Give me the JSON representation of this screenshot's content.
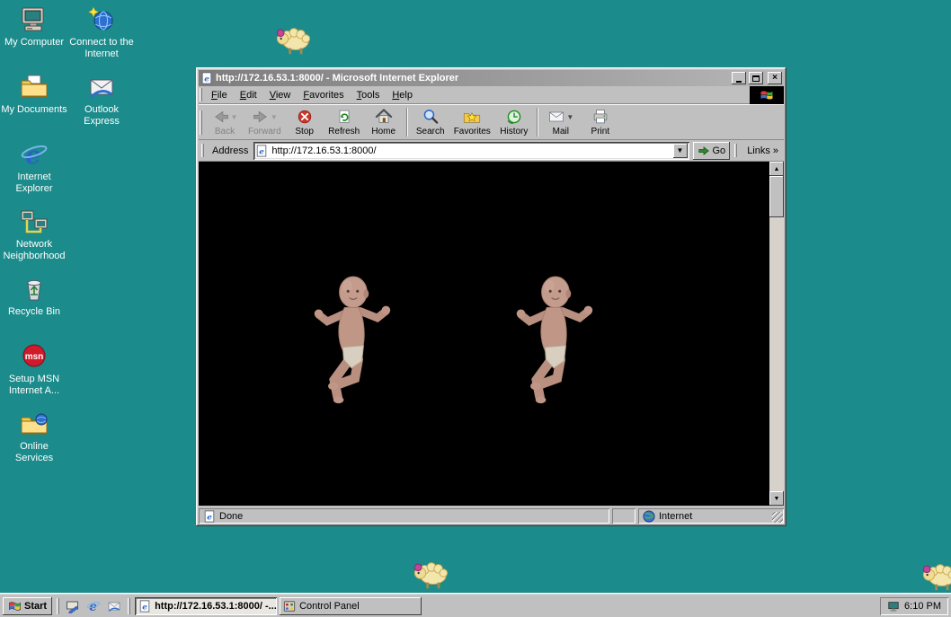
{
  "colors": {
    "desktop_teal": "#1b8b8b",
    "window_face": "#c0c0c0",
    "title_gradient_start": "#7d7d7d",
    "title_gradient_end": "#b6b6b6",
    "content_background": "#000000",
    "msn_red": "#cf1b2b",
    "stop_red": "#c9372a",
    "go_green": "#2d8a2d"
  },
  "desktop": {
    "icons": [
      {
        "name": "my-computer",
        "label": "My Computer"
      },
      {
        "name": "connect-internet",
        "label": "Connect to the Internet"
      },
      {
        "name": "my-documents",
        "label": "My Documents"
      },
      {
        "name": "outlook-express",
        "label": "Outlook Express"
      },
      {
        "name": "internet-explorer",
        "label": "Internet Explorer"
      },
      {
        "name": "network-neighborhood",
        "label": "Network Neighborhood"
      },
      {
        "name": "recycle-bin",
        "label": "Recycle Bin"
      },
      {
        "name": "setup-msn",
        "label": "Setup MSN Internet A..."
      },
      {
        "name": "online-services",
        "label": "Online Services"
      }
    ]
  },
  "icons_text": {
    "msn": "msn"
  },
  "ie": {
    "title": "http://172.16.53.1:8000/ - Microsoft Internet Explorer",
    "menu": {
      "file": "File",
      "edit": "Edit",
      "view": "View",
      "favorites": "Favorites",
      "tools": "Tools",
      "help": "Help"
    },
    "toolbar": {
      "back": "Back",
      "forward": "Forward",
      "stop": "Stop",
      "refresh": "Refresh",
      "home": "Home",
      "search": "Search",
      "favorites": "Favorites",
      "history": "History",
      "mail": "Mail",
      "print": "Print"
    },
    "address": {
      "label": "Address",
      "value": "http://172.16.53.1:8000/",
      "go": "Go",
      "links": "Links",
      "links_chevron": "»"
    },
    "status": {
      "done": "Done",
      "zone": "Internet"
    }
  },
  "taskbar": {
    "start": "Start",
    "tasks": [
      {
        "label": "http://172.16.53.1:8000/ -...",
        "active": true
      },
      {
        "label": "Control Panel",
        "active": false
      }
    ],
    "clock": "6:10 PM"
  }
}
